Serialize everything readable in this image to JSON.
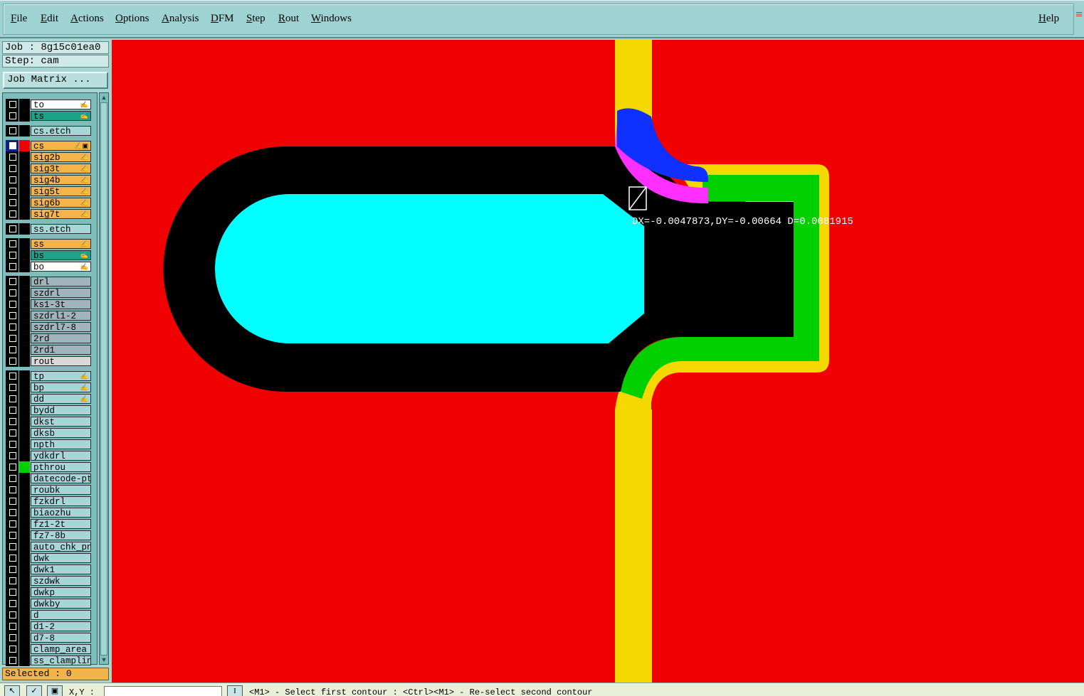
{
  "menu": {
    "items": [
      "File",
      "Edit",
      "Actions",
      "Options",
      "Analysis",
      "DFM",
      "Step",
      "Rout",
      "Windows"
    ],
    "help": "Help"
  },
  "job": {
    "label": "Job : 8g15c01ea0",
    "step": "Step: cam",
    "matrix_button": "Job Matrix ..."
  },
  "layers": [
    {
      "name": "to",
      "bg": "#ffffff",
      "mark": "✍",
      "gap": 0
    },
    {
      "name": "ts",
      "bg": "#1fa088",
      "mark": "✍",
      "gap": 0
    },
    {
      "name": "cs.etch",
      "bg": "#a6d6d6",
      "mark": "",
      "gap": 1
    },
    {
      "name": "cs",
      "bg": "#f5b44a",
      "mark": "✍▣",
      "gap": 1,
      "active": true,
      "swatch": "#f00000"
    },
    {
      "name": "sig2b",
      "bg": "#f5b44a",
      "mark": "✍",
      "gap": 0
    },
    {
      "name": "sig3t",
      "bg": "#f5b44a",
      "mark": "✍",
      "gap": 0
    },
    {
      "name": "sig4b",
      "bg": "#f5b44a",
      "mark": "✍",
      "gap": 0
    },
    {
      "name": "sig5t",
      "bg": "#f5b44a",
      "mark": "✍",
      "gap": 0
    },
    {
      "name": "sig6b",
      "bg": "#f5b44a",
      "mark": "✍",
      "gap": 0
    },
    {
      "name": "sig7t",
      "bg": "#f5b44a",
      "mark": "✍",
      "gap": 0
    },
    {
      "name": "ss.etch",
      "bg": "#a6d6d6",
      "mark": "",
      "gap": 1
    },
    {
      "name": "ss",
      "bg": "#f5b44a",
      "mark": "✍",
      "gap": 1
    },
    {
      "name": "bs",
      "bg": "#1fa088",
      "mark": "✍",
      "gap": 0
    },
    {
      "name": "bo",
      "bg": "#ffffff",
      "mark": "✍",
      "gap": 0
    },
    {
      "name": "drl",
      "bg": "#a0b4bc",
      "mark": "",
      "gap": 1
    },
    {
      "name": "szdrl",
      "bg": "#a0b4bc",
      "mark": "",
      "gap": 0
    },
    {
      "name": "ks1-3t",
      "bg": "#a0b4bc",
      "mark": "",
      "gap": 0
    },
    {
      "name": "szdrl1-2",
      "bg": "#a0b4bc",
      "mark": "",
      "gap": 0
    },
    {
      "name": "szdrl7-8",
      "bg": "#a0b4bc",
      "mark": "",
      "gap": 0
    },
    {
      "name": "2rd",
      "bg": "#a0b4bc",
      "mark": "",
      "gap": 0
    },
    {
      "name": "2rd1",
      "bg": "#a0b4bc",
      "mark": "",
      "gap": 0
    },
    {
      "name": "rout",
      "bg": "#d8d8d8",
      "mark": "",
      "gap": 0
    },
    {
      "name": "tp",
      "bg": "#a6d6d6",
      "mark": "✍",
      "gap": 1
    },
    {
      "name": "bp",
      "bg": "#a6d6d6",
      "mark": "✍",
      "gap": 0
    },
    {
      "name": "dd",
      "bg": "#a6d6d6",
      "mark": "✍",
      "gap": 0
    },
    {
      "name": "bydd",
      "bg": "#a6d6d6",
      "mark": "",
      "gap": 0
    },
    {
      "name": "dkst",
      "bg": "#a6d6d6",
      "mark": "",
      "gap": 0
    },
    {
      "name": "dksb",
      "bg": "#a6d6d6",
      "mark": "",
      "gap": 0
    },
    {
      "name": "npth",
      "bg": "#a6d6d6",
      "mark": "",
      "gap": 0
    },
    {
      "name": "ydkdrl",
      "bg": "#a6d6d6",
      "mark": "",
      "gap": 0
    },
    {
      "name": "pthrou",
      "bg": "#a6d6d6",
      "mark": "",
      "gap": 0,
      "swatch": "#00d000"
    },
    {
      "name": "datecode-pte",
      "bg": "#a6d6d6",
      "mark": "",
      "gap": 0
    },
    {
      "name": "roubk",
      "bg": "#a6d6d6",
      "mark": "",
      "gap": 0
    },
    {
      "name": "fzkdrl",
      "bg": "#a6d6d6",
      "mark": "",
      "gap": 0
    },
    {
      "name": "biaozhu",
      "bg": "#a6d6d6",
      "mark": "",
      "gap": 0
    },
    {
      "name": "fz1-2t",
      "bg": "#a6d6d6",
      "mark": "",
      "gap": 0
    },
    {
      "name": "fz7-8b",
      "bg": "#a6d6d6",
      "mark": "",
      "gap": 0
    },
    {
      "name": "auto_chk_pnl",
      "bg": "#a6d6d6",
      "mark": "",
      "gap": 0
    },
    {
      "name": "dwk",
      "bg": "#a6d6d6",
      "mark": "",
      "gap": 0
    },
    {
      "name": "dwk1",
      "bg": "#a6d6d6",
      "mark": "",
      "gap": 0
    },
    {
      "name": "szdwk",
      "bg": "#a6d6d6",
      "mark": "",
      "gap": 0
    },
    {
      "name": "dwkp",
      "bg": "#a6d6d6",
      "mark": "",
      "gap": 0
    },
    {
      "name": "dwkby",
      "bg": "#a6d6d6",
      "mark": "",
      "gap": 0
    },
    {
      "name": "d",
      "bg": "#a6d6d6",
      "mark": "",
      "gap": 0
    },
    {
      "name": "d1-2",
      "bg": "#a6d6d6",
      "mark": "",
      "gap": 0
    },
    {
      "name": "d7-8",
      "bg": "#a6d6d6",
      "mark": "",
      "gap": 0
    },
    {
      "name": "clamp_area",
      "bg": "#a6d6d6",
      "mark": "",
      "gap": 0
    },
    {
      "name": "ss_clampline",
      "bg": "#a6d6d6",
      "mark": "",
      "gap": 0
    }
  ],
  "status": {
    "selected": "Selected : 0"
  },
  "measurement": {
    "text": "DX=-0.0047873,DY=-0.00664 D=0.0081915"
  },
  "bottom": {
    "xy_label": "X,Y :",
    "xy_value": "",
    "prompt": "<M1> - Select first contour : <Ctrl><M1> - Re-select second contour"
  },
  "colors": {
    "canvas": "#f00000",
    "trace": "#f5d800",
    "pad": "#00d000",
    "clearance": "#000000",
    "cutout": "#00ffff",
    "highlight_a": "#1030ff",
    "highlight_b": "#ff30ff"
  }
}
